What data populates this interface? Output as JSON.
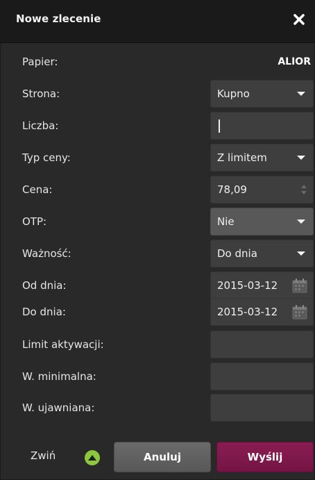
{
  "window": {
    "title": "Nowe zlecenie"
  },
  "form": {
    "paper_label": "Papier:",
    "paper_value": "ALIOR",
    "strona_label": "Strona:",
    "strona_value": "Kupno",
    "liczba_label": "Liczba:",
    "liczba_value": "",
    "typ_ceny_label": "Typ ceny:",
    "typ_ceny_value": "Z limitem",
    "cena_label": "Cena:",
    "cena_value": "78,09",
    "otp_label": "OTP:",
    "otp_value": "Nie",
    "waznosc_label": "Ważność:",
    "waznosc_value": "Do dnia",
    "od_dnia_label": "Od dnia:",
    "od_dnia_value": "2015-03-12",
    "do_dnia_label": "Do dnia:",
    "do_dnia_value": "2015-03-12",
    "limit_label": "Limit aktywacji:",
    "limit_value": "",
    "w_min_label": "W. minimalna:",
    "w_min_value": "",
    "w_ujaw_label": "W. ujawniana:",
    "w_ujaw_value": ""
  },
  "footer": {
    "collapse_label": "Zwiń",
    "cancel_label": "Anuluj",
    "send_label": "Wyślij"
  },
  "icons": {
    "close": "close-icon",
    "dropdown": "chevron-down-icon",
    "spinner": "spinner-arrows-icon",
    "calendar": "calendar-icon",
    "collapse": "chevron-up-icon"
  },
  "colors": {
    "send_button": "#7f1a4c",
    "collapse_toggle": "#8dc63f"
  }
}
